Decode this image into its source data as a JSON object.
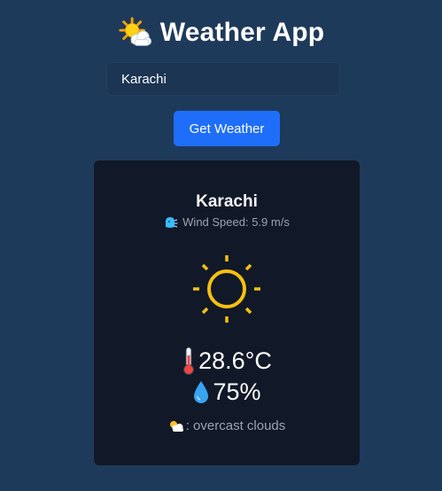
{
  "app": {
    "title": "Weather App",
    "logo_icon": "sun-behind-cloud-icon"
  },
  "search": {
    "value": "Karachi",
    "placeholder": ""
  },
  "button": {
    "label": "Get Weather"
  },
  "weather": {
    "city": "Karachi",
    "wind_label": "Wind Speed: 5.9 m/s",
    "temperature": "28.6°C",
    "humidity": "75%",
    "description": ": overcast clouds"
  },
  "colors": {
    "background": "#1e3a5a",
    "card": "#111827",
    "button": "#1e6ef9",
    "sun": "#f5c010"
  }
}
